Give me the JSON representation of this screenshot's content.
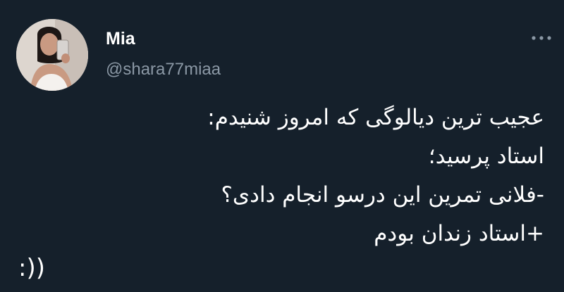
{
  "author": {
    "display_name": "Mia",
    "handle": "@shara77miaa",
    "avatar_icon": "profile-photo"
  },
  "more_icon": "more-options-icon",
  "tweet": {
    "lines": [
      "عجیب ترین دیالوگی که امروز شنیدم:",
      "استاد پرسید؛",
      "-فلانی تمرین این درسو انجام دادی؟",
      "+استاد زندان بودم"
    ],
    "emoticon": ":))"
  },
  "colors": {
    "background": "#15202b",
    "text": "#ffffff",
    "secondary_text": "#8b98a5"
  }
}
